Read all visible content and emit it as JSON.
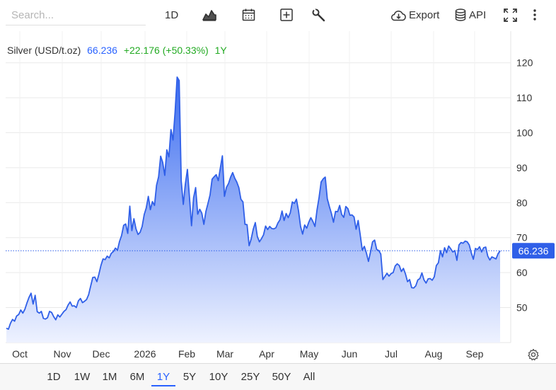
{
  "toolbar": {
    "search_placeholder": "Search...",
    "interval_label": "1D",
    "export_label": "Export",
    "api_label": "API"
  },
  "legend": {
    "name": "Silver (USD/t.oz)",
    "last": "66.236",
    "change": "+22.176 (+50.33%)",
    "period": "1Y"
  },
  "price_tag": "66.236",
  "colors": {
    "line": "#2f5fe8",
    "fill_top": "#3b6cf0",
    "fill_bottom": "#eef2ff",
    "last_value_text": "#2962ff",
    "positive_change": "#22aa22",
    "price_tag_bg": "#2f5fe8"
  },
  "ranges": [
    "1D",
    "1W",
    "1M",
    "6M",
    "1Y",
    "5Y",
    "10Y",
    "25Y",
    "50Y",
    "All"
  ],
  "active_range": "1Y",
  "chart_data": {
    "type": "area",
    "x_axis_labels": [
      "Oct",
      "Nov",
      "Dec",
      "2026",
      "Feb",
      "Mar",
      "Apr",
      "May",
      "Jun",
      "Jul",
      "Aug",
      "Sep"
    ],
    "y_ticks": [
      50,
      60,
      70,
      80,
      90,
      100,
      110,
      120
    ],
    "ylim": [
      40.6,
      126
    ],
    "y_axis_position": "right",
    "grid": true,
    "last_value": 66.236,
    "series": [
      {
        "values": [
          44.1,
          43.8,
          45.5,
          46.6,
          46.1,
          47.6,
          48.0,
          49.3,
          48.4,
          49.5,
          51.3,
          52.9,
          54.1,
          51.0,
          53.5,
          48.8,
          48.4,
          48.9,
          46.9,
          46.7,
          47.1,
          48.9,
          48.6,
          47.4,
          46.5,
          47.9,
          47.3,
          48.1,
          48.9,
          49.4,
          50.7,
          51.6,
          50.4,
          50.5,
          50.0,
          51.9,
          52.6,
          51.4,
          51.8,
          52.3,
          53.7,
          56.2,
          58.6,
          58.7,
          57.4,
          59.6,
          62.1,
          63.9,
          63.7,
          64.7,
          64.2,
          65.5,
          66.0,
          67.0,
          66.4,
          68.9,
          70.6,
          73.5,
          73.9,
          71.2,
          79.0,
          72.0,
          75.4,
          72.5,
          70.9,
          71.5,
          73.2,
          76.6,
          78.5,
          81.8,
          78.0,
          80.3,
          79.2,
          85.0,
          87.4,
          93.3,
          91.5,
          87.8,
          95.1,
          93.1,
          100.9,
          97.9,
          105.8,
          115.9,
          114.9,
          86.2,
          79.5,
          85.3,
          89.5,
          81.6,
          73.4,
          81.4,
          84.3,
          76.7,
          78.1,
          77.0,
          73.8,
          77.5,
          79.8,
          82.2,
          86.7,
          87.4,
          88.0,
          86.3,
          89.9,
          93.4,
          81.8,
          84.4,
          85.5,
          87.3,
          88.6,
          87.0,
          85.9,
          84.3,
          81.0,
          80.2,
          73.8,
          73.7,
          67.7,
          69.6,
          72.4,
          74.3,
          70.3,
          68.8,
          69.7,
          70.8,
          73.3,
          72.3,
          73.2,
          72.6,
          72.5,
          72.8,
          74.2,
          75.1,
          77.6,
          74.9,
          76.9,
          75.7,
          77.1,
          80.2,
          79.8,
          81.0,
          77.7,
          73.2,
          71.0,
          73.6,
          72.7,
          74.4,
          75.7,
          74.6,
          73.2,
          77.9,
          81.5,
          85.9,
          86.8,
          87.3,
          81.1,
          78.9,
          76.9,
          74.4,
          77.5,
          77.4,
          79.2,
          76.6,
          75.8,
          78.9,
          78.3,
          76.4,
          76.5,
          75.9,
          72.4,
          74.9,
          70.8,
          66.4,
          67.5,
          65.6,
          63.2,
          65.9,
          68.8,
          69.3,
          66.6,
          66.3,
          65.3,
          58.0,
          58.9,
          59.8,
          59.0,
          59.7,
          60.0,
          61.9,
          62.5,
          62.0,
          60.3,
          61.2,
          59.6,
          57.4,
          58.0,
          55.7,
          55.6,
          56.2,
          57.9,
          58.3,
          59.9,
          57.9,
          57.0,
          58.2,
          58.3,
          57.8,
          58.8,
          62.0,
          62.8,
          66.3,
          64.5,
          67.1,
          65.7,
          67.6,
          66.8,
          65.9,
          66.3,
          63.5,
          67.9,
          68.6,
          68.4,
          69.0,
          68.8,
          67.9,
          65.6,
          63.8,
          66.9,
          66.6,
          67.4,
          65.9,
          67.1,
          67.3,
          64.7,
          63.6,
          64.5,
          64.2,
          63.9,
          65.4,
          66.2
        ]
      }
    ]
  }
}
